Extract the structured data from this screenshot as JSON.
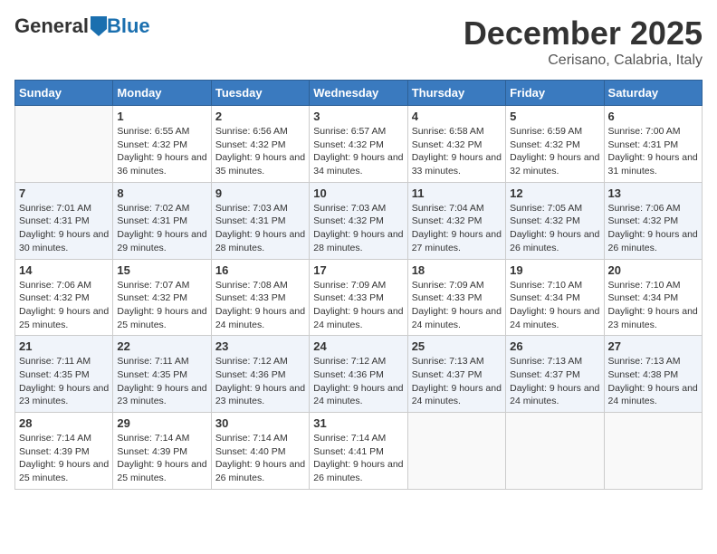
{
  "header": {
    "logo_general": "General",
    "logo_blue": "Blue",
    "month_title": "December 2025",
    "location": "Cerisano, Calabria, Italy"
  },
  "columns": [
    "Sunday",
    "Monday",
    "Tuesday",
    "Wednesday",
    "Thursday",
    "Friday",
    "Saturday"
  ],
  "weeks": [
    [
      {
        "day": "",
        "sunrise": "",
        "sunset": "",
        "daylight": ""
      },
      {
        "day": "1",
        "sunrise": "Sunrise: 6:55 AM",
        "sunset": "Sunset: 4:32 PM",
        "daylight": "Daylight: 9 hours and 36 minutes."
      },
      {
        "day": "2",
        "sunrise": "Sunrise: 6:56 AM",
        "sunset": "Sunset: 4:32 PM",
        "daylight": "Daylight: 9 hours and 35 minutes."
      },
      {
        "day": "3",
        "sunrise": "Sunrise: 6:57 AM",
        "sunset": "Sunset: 4:32 PM",
        "daylight": "Daylight: 9 hours and 34 minutes."
      },
      {
        "day": "4",
        "sunrise": "Sunrise: 6:58 AM",
        "sunset": "Sunset: 4:32 PM",
        "daylight": "Daylight: 9 hours and 33 minutes."
      },
      {
        "day": "5",
        "sunrise": "Sunrise: 6:59 AM",
        "sunset": "Sunset: 4:32 PM",
        "daylight": "Daylight: 9 hours and 32 minutes."
      },
      {
        "day": "6",
        "sunrise": "Sunrise: 7:00 AM",
        "sunset": "Sunset: 4:31 PM",
        "daylight": "Daylight: 9 hours and 31 minutes."
      }
    ],
    [
      {
        "day": "7",
        "sunrise": "Sunrise: 7:01 AM",
        "sunset": "Sunset: 4:31 PM",
        "daylight": "Daylight: 9 hours and 30 minutes."
      },
      {
        "day": "8",
        "sunrise": "Sunrise: 7:02 AM",
        "sunset": "Sunset: 4:31 PM",
        "daylight": "Daylight: 9 hours and 29 minutes."
      },
      {
        "day": "9",
        "sunrise": "Sunrise: 7:03 AM",
        "sunset": "Sunset: 4:31 PM",
        "daylight": "Daylight: 9 hours and 28 minutes."
      },
      {
        "day": "10",
        "sunrise": "Sunrise: 7:03 AM",
        "sunset": "Sunset: 4:32 PM",
        "daylight": "Daylight: 9 hours and 28 minutes."
      },
      {
        "day": "11",
        "sunrise": "Sunrise: 7:04 AM",
        "sunset": "Sunset: 4:32 PM",
        "daylight": "Daylight: 9 hours and 27 minutes."
      },
      {
        "day": "12",
        "sunrise": "Sunrise: 7:05 AM",
        "sunset": "Sunset: 4:32 PM",
        "daylight": "Daylight: 9 hours and 26 minutes."
      },
      {
        "day": "13",
        "sunrise": "Sunrise: 7:06 AM",
        "sunset": "Sunset: 4:32 PM",
        "daylight": "Daylight: 9 hours and 26 minutes."
      }
    ],
    [
      {
        "day": "14",
        "sunrise": "Sunrise: 7:06 AM",
        "sunset": "Sunset: 4:32 PM",
        "daylight": "Daylight: 9 hours and 25 minutes."
      },
      {
        "day": "15",
        "sunrise": "Sunrise: 7:07 AM",
        "sunset": "Sunset: 4:32 PM",
        "daylight": "Daylight: 9 hours and 25 minutes."
      },
      {
        "day": "16",
        "sunrise": "Sunrise: 7:08 AM",
        "sunset": "Sunset: 4:33 PM",
        "daylight": "Daylight: 9 hours and 24 minutes."
      },
      {
        "day": "17",
        "sunrise": "Sunrise: 7:09 AM",
        "sunset": "Sunset: 4:33 PM",
        "daylight": "Daylight: 9 hours and 24 minutes."
      },
      {
        "day": "18",
        "sunrise": "Sunrise: 7:09 AM",
        "sunset": "Sunset: 4:33 PM",
        "daylight": "Daylight: 9 hours and 24 minutes."
      },
      {
        "day": "19",
        "sunrise": "Sunrise: 7:10 AM",
        "sunset": "Sunset: 4:34 PM",
        "daylight": "Daylight: 9 hours and 24 minutes."
      },
      {
        "day": "20",
        "sunrise": "Sunrise: 7:10 AM",
        "sunset": "Sunset: 4:34 PM",
        "daylight": "Daylight: 9 hours and 23 minutes."
      }
    ],
    [
      {
        "day": "21",
        "sunrise": "Sunrise: 7:11 AM",
        "sunset": "Sunset: 4:35 PM",
        "daylight": "Daylight: 9 hours and 23 minutes."
      },
      {
        "day": "22",
        "sunrise": "Sunrise: 7:11 AM",
        "sunset": "Sunset: 4:35 PM",
        "daylight": "Daylight: 9 hours and 23 minutes."
      },
      {
        "day": "23",
        "sunrise": "Sunrise: 7:12 AM",
        "sunset": "Sunset: 4:36 PM",
        "daylight": "Daylight: 9 hours and 23 minutes."
      },
      {
        "day": "24",
        "sunrise": "Sunrise: 7:12 AM",
        "sunset": "Sunset: 4:36 PM",
        "daylight": "Daylight: 9 hours and 24 minutes."
      },
      {
        "day": "25",
        "sunrise": "Sunrise: 7:13 AM",
        "sunset": "Sunset: 4:37 PM",
        "daylight": "Daylight: 9 hours and 24 minutes."
      },
      {
        "day": "26",
        "sunrise": "Sunrise: 7:13 AM",
        "sunset": "Sunset: 4:37 PM",
        "daylight": "Daylight: 9 hours and 24 minutes."
      },
      {
        "day": "27",
        "sunrise": "Sunrise: 7:13 AM",
        "sunset": "Sunset: 4:38 PM",
        "daylight": "Daylight: 9 hours and 24 minutes."
      }
    ],
    [
      {
        "day": "28",
        "sunrise": "Sunrise: 7:14 AM",
        "sunset": "Sunset: 4:39 PM",
        "daylight": "Daylight: 9 hours and 25 minutes."
      },
      {
        "day": "29",
        "sunrise": "Sunrise: 7:14 AM",
        "sunset": "Sunset: 4:39 PM",
        "daylight": "Daylight: 9 hours and 25 minutes."
      },
      {
        "day": "30",
        "sunrise": "Sunrise: 7:14 AM",
        "sunset": "Sunset: 4:40 PM",
        "daylight": "Daylight: 9 hours and 26 minutes."
      },
      {
        "day": "31",
        "sunrise": "Sunrise: 7:14 AM",
        "sunset": "Sunset: 4:41 PM",
        "daylight": "Daylight: 9 hours and 26 minutes."
      },
      {
        "day": "",
        "sunrise": "",
        "sunset": "",
        "daylight": ""
      },
      {
        "day": "",
        "sunrise": "",
        "sunset": "",
        "daylight": ""
      },
      {
        "day": "",
        "sunrise": "",
        "sunset": "",
        "daylight": ""
      }
    ]
  ]
}
